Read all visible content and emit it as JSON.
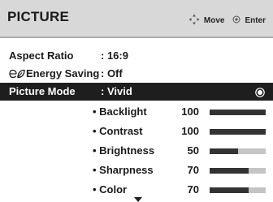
{
  "menu": {
    "title": "PICTURE",
    "hints": {
      "move_label": "Move",
      "enter_label": "Enter",
      "move_icon": "four-way-arrow-icon",
      "enter_icon": "ok-circle-icon"
    },
    "rows": [
      {
        "label": "Aspect Ratio",
        "value": ": 16:9"
      },
      {
        "label": "Energy Saving",
        "value": ": Off",
        "icon": "leaf-icon"
      },
      {
        "label": "Picture Mode",
        "value": ": Vivid",
        "selected": true,
        "icon": "radio-selected-icon"
      }
    ],
    "settings": [
      {
        "label": "• Backlight",
        "value": "100",
        "level": 1.0
      },
      {
        "label": "• Contrast",
        "value": "100",
        "level": 1.0
      },
      {
        "label": "• Brightness",
        "value": "50",
        "level": 0.5
      },
      {
        "label": "• Sharpness",
        "value": "70",
        "level": 0.7
      },
      {
        "label": "• Color",
        "value": "70",
        "level": 0.7
      }
    ],
    "scroll_indicator": "scroll-down-arrow-icon"
  },
  "colors": {
    "header_bg": "#d8d8d8",
    "selected_bg": "#1e1e1e",
    "bar_fill": "#333333",
    "bar_track": "#c4c4c4"
  }
}
